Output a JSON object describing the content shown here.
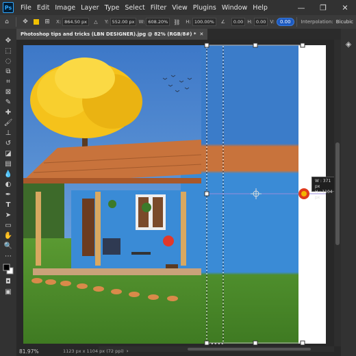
{
  "app": {
    "logo": "Ps"
  },
  "menu": [
    "File",
    "Edit",
    "Image",
    "Layer",
    "Type",
    "Select",
    "Filter",
    "View",
    "Plugins",
    "Window",
    "Help"
  ],
  "window_controls": [
    "—",
    "❐",
    "✕"
  ],
  "options": {
    "x_label": "X:",
    "x_value": "864.50 px",
    "y_label": "Y:",
    "y_value": "552.00 px",
    "w_label": "W:",
    "w_value": "608.20%",
    "h_label": "H:",
    "h_value": "100.00%",
    "angle_value": "0.00",
    "hskew_label": "H:",
    "hskew_value": "0.00",
    "vskew_label": "V:",
    "vskew_value": "0.00",
    "interpolation_label": "Interpolation:",
    "interpolation_value": "Bicubic"
  },
  "document_tab": {
    "label": "Photoshop tips and tricks (LBN DESIGNER).jpg @ 82% (RGB/8#) *"
  },
  "transform_tooltip": {
    "w_line": "W :   371 px",
    "h_line": "H : 1104 px"
  },
  "status": {
    "zoom": "81.97%",
    "doc_info": "1123 px x 1104 px (72 ppi)"
  },
  "colors": {
    "accent": "#1d5ac0",
    "sky": "#3f7fd0",
    "wall": "#3a8bd6",
    "roof": "#c8733c",
    "tree": "#f5c21b",
    "grass": "#4c8f2b",
    "handle": "#f2b400"
  },
  "icons": {
    "toolbar": [
      "move-icon",
      "marquee-icon",
      "lasso-icon",
      "object-select-icon",
      "crop-icon",
      "frame-icon",
      "eyedropper-icon",
      "healing-icon",
      "brush-icon",
      "stamp-icon",
      "history-brush-icon",
      "eraser-icon",
      "gradient-icon",
      "blur-icon",
      "dodge-icon",
      "pen-icon",
      "type-icon",
      "path-select-icon",
      "rectangle-icon",
      "hand-icon",
      "zoom-icon",
      "more-tools-icon",
      "color-swatch-icon",
      "quick-mask-icon",
      "screen-mode-icon"
    ]
  }
}
